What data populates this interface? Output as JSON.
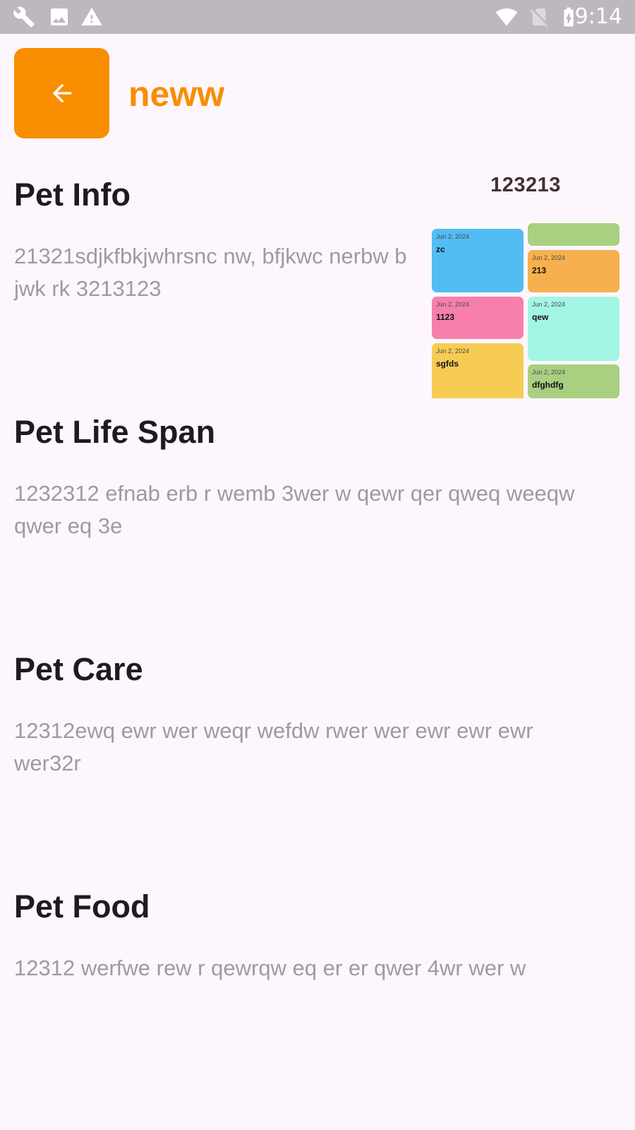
{
  "status_bar": {
    "time": "9:14",
    "icons_left": [
      "wrench-icon",
      "image-icon",
      "warning-icon"
    ],
    "icons_right": [
      "wifi-icon",
      "no-sim-icon",
      "battery-charging-icon"
    ],
    "color": "#bdb8be"
  },
  "header": {
    "back_icon": "arrow-left-icon",
    "title": "neww",
    "accent_color": "#f98d00"
  },
  "sections": {
    "pet_info": {
      "title": "Pet Info",
      "body": "21321sdjkfbkjwhrsnc nw, bfjkwc nerbw b jwk rk 3213123"
    },
    "pet_life_span": {
      "title": "Pet Life Span",
      "body": "1232312  efnab erb   r wemb 3wer w qewr qer qweq weeqw qwer eq 3e"
    },
    "pet_care": {
      "title": "Pet Care",
      "body": "12312ewq ewr wer weqr wefdw rwer wer ewr ewr ewr wer32r"
    },
    "pet_food": {
      "title": "Pet Food",
      "body": "12312 werfwe rew r  qewrqw eq er er qwer 4wr wer w"
    }
  },
  "notes_preview": {
    "label": "123213",
    "cards": [
      {
        "date": "Jun 2, 2024",
        "title": "zc",
        "color": "#51bdf2"
      },
      {
        "date": "",
        "title": "",
        "color": "#a9cf80"
      },
      {
        "date": "Jun 2, 2024",
        "title": "213",
        "color": "#f6b04f"
      },
      {
        "date": "Jun 2, 2024",
        "title": "1123",
        "color": "#f67fac"
      },
      {
        "date": "Jun 2, 2024",
        "title": "qew",
        "color": "#a4f6e4"
      },
      {
        "date": "Jun 2, 2024",
        "title": "sgfds",
        "color": "#f7cc55"
      },
      {
        "date": "Jun 2, 2024",
        "title": "dfghdfg",
        "color": "#a9cf80"
      }
    ]
  }
}
